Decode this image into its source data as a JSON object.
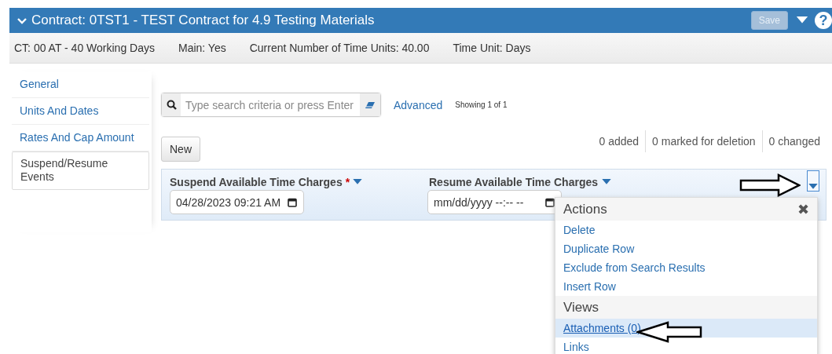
{
  "header": {
    "title": "Contract: 0TST1 - TEST Contract for 4.9 Testing Materials",
    "expanded": true,
    "save_button": {
      "label": "Save",
      "disabled": true
    },
    "help": "?"
  },
  "info_bar": [
    "CT: 00 AT - 40 Working Days",
    "Main: Yes",
    "Current Number of Time Units: 40.00",
    "Time Unit: Days"
  ],
  "sidebar": {
    "items": [
      {
        "label": "General",
        "selected": false
      },
      {
        "label": "Units And Dates",
        "selected": false
      },
      {
        "label": "Rates And Cap Amount",
        "selected": false
      },
      {
        "label": "Suspend/Resume Events",
        "selected": true
      }
    ]
  },
  "search": {
    "placeholder": "Type search criteria or press Enter",
    "advanced_link": "Advanced",
    "showing": "Showing 1 of 1"
  },
  "new_button": "New",
  "counters": [
    "0 added",
    "0 marked for deletion",
    "0 changed"
  ],
  "table": {
    "columns": [
      {
        "label": "Suspend Available Time Charges",
        "required_mark": "*"
      },
      {
        "label": "Resume Available Time Charges"
      }
    ],
    "rows": [
      {
        "cells": [
          "04/28/2023 09:21  AM",
          "mm/dd/yyyy --:-- --"
        ],
        "menu_open": true
      }
    ]
  },
  "row_menu": {
    "close": "✖",
    "items": [
      {
        "kind": "header",
        "label": "Actions"
      },
      {
        "kind": "item",
        "label": "Delete",
        "selected": false
      },
      {
        "kind": "item",
        "label": "Duplicate Row",
        "selected": false
      },
      {
        "kind": "item",
        "label": "Exclude from Search Results",
        "selected": false
      },
      {
        "kind": "item",
        "label": "Insert Row",
        "selected": false
      },
      {
        "kind": "header",
        "label": "Views"
      },
      {
        "kind": "item",
        "label": "Attachments (0)",
        "selected": true
      },
      {
        "kind": "item",
        "label": "Links",
        "selected": false
      }
    ]
  }
}
